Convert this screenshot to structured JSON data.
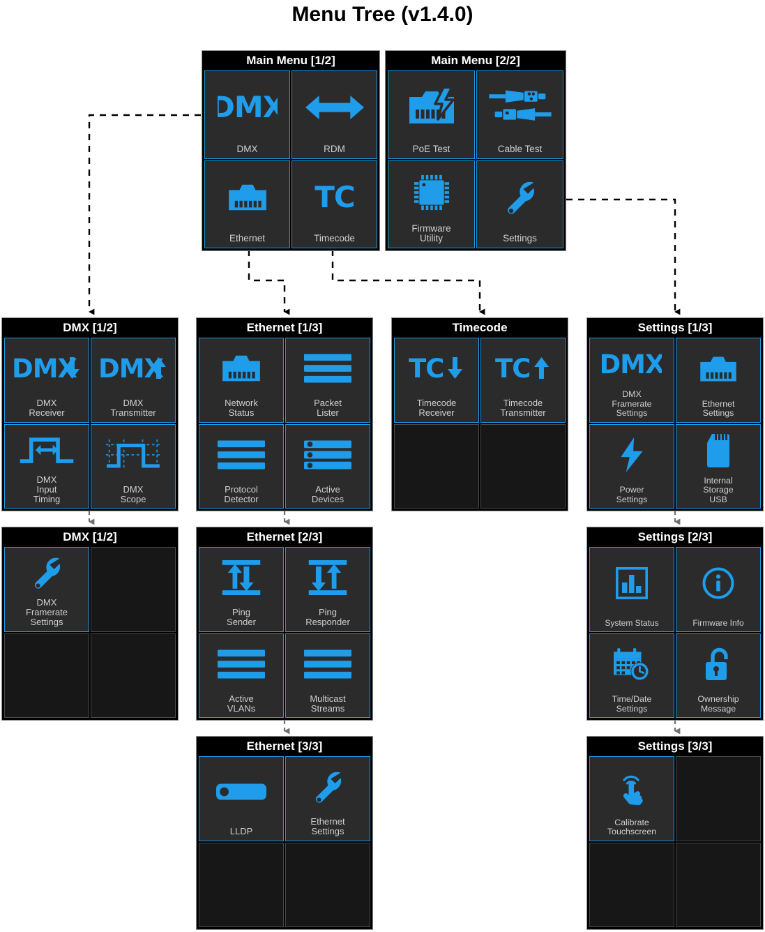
{
  "title": "Menu Tree (v1.4.0)",
  "colors": {
    "accent": "#1f9cea",
    "panel_bg": "#000000",
    "tile_bg": "#2b2b2b",
    "tile_empty_bg": "#171717",
    "label": "#d0d0d0",
    "page_bg": "#ffffff"
  },
  "panels": [
    {
      "id": "main-menu-1",
      "title": "Main Menu [1/2]",
      "tiles": [
        {
          "label": "DMX",
          "icon": "dmx-wordmark-icon"
        },
        {
          "label": "RDM",
          "icon": "double-arrow-icon"
        },
        {
          "label": "Ethernet",
          "icon": "rj45-jack-icon"
        },
        {
          "label": "Timecode",
          "icon": "tc-wordmark-icon"
        }
      ]
    },
    {
      "id": "main-menu-2",
      "title": "Main Menu [2/2]",
      "tiles": [
        {
          "label": "PoE Test",
          "icon": "poe-jack-bolt-icon"
        },
        {
          "label": "Cable Test",
          "icon": "xlr-connectors-icon"
        },
        {
          "label": "Firmware\nUtility",
          "icon": "chip-icon"
        },
        {
          "label": "Settings",
          "icon": "wrench-icon"
        }
      ]
    },
    {
      "id": "dmx-1",
      "title": "DMX [1/2]",
      "tiles": [
        {
          "label": "DMX\nReceiver",
          "icon": "dmx-down-arrow-icon"
        },
        {
          "label": "DMX\nTransmitter",
          "icon": "dmx-up-arrow-icon"
        },
        {
          "label": "DMX\nInput\nTiming",
          "icon": "pulse-width-icon"
        },
        {
          "label": "DMX\nScope",
          "icon": "scope-waveform-icon"
        }
      ]
    },
    {
      "id": "dmx-2",
      "title": "DMX [1/2]",
      "tiles": [
        {
          "label": "DMX\nFramerate\nSettings",
          "icon": "wrench-icon"
        },
        {
          "label": "",
          "icon": "none"
        },
        {
          "label": "",
          "icon": "none"
        },
        {
          "label": "",
          "icon": "none"
        }
      ]
    },
    {
      "id": "ethernet-1",
      "title": "Ethernet [1/3]",
      "tiles": [
        {
          "label": "Network\nStatus",
          "icon": "rj45-jack-icon"
        },
        {
          "label": "Packet\nLister",
          "icon": "list-bars-icon"
        },
        {
          "label": "Protocol\nDetector",
          "icon": "list-bars-icon"
        },
        {
          "label": "Active\nDevices",
          "icon": "device-list-icon"
        }
      ]
    },
    {
      "id": "ethernet-2",
      "title": "Ethernet [2/3]",
      "tiles": [
        {
          "label": "Ping\nSender",
          "icon": "ping-sender-icon"
        },
        {
          "label": "Ping\nResponder",
          "icon": "ping-responder-icon"
        },
        {
          "label": "Active\nVLANs",
          "icon": "list-bars-icon"
        },
        {
          "label": "Multicast\nStreams",
          "icon": "list-bars-icon"
        }
      ]
    },
    {
      "id": "ethernet-3",
      "title": "Ethernet [3/3]",
      "tiles": [
        {
          "label": "LLDP",
          "icon": "pill-tag-icon"
        },
        {
          "label": "Ethernet\nSettings",
          "icon": "wrench-icon"
        },
        {
          "label": "",
          "icon": "none"
        },
        {
          "label": "",
          "icon": "none"
        }
      ]
    },
    {
      "id": "timecode-1",
      "title": "Timecode",
      "tiles": [
        {
          "label": "Timecode\nReceiver",
          "icon": "tc-down-arrow-icon"
        },
        {
          "label": "Timecode\nTransmitter",
          "icon": "tc-up-arrow-icon"
        },
        {
          "label": "",
          "icon": "none"
        },
        {
          "label": "",
          "icon": "none"
        }
      ]
    },
    {
      "id": "settings-1",
      "title": "Settings [1/3]",
      "tiles": [
        {
          "label": "DMX\nFramerate\nSettings",
          "icon": "dmx-wordmark-icon"
        },
        {
          "label": "Ethernet\nSettings",
          "icon": "rj45-jack-icon"
        },
        {
          "label": "Power\nSettings",
          "icon": "bolt-icon"
        },
        {
          "label": "Internal\nStorage\nUSB",
          "icon": "sd-card-icon"
        }
      ]
    },
    {
      "id": "settings-2",
      "title": "Settings [2/3]",
      "tiles": [
        {
          "label": "System Status",
          "icon": "bar-chart-icon"
        },
        {
          "label": "Firmware Info",
          "icon": "info-circle-icon"
        },
        {
          "label": "Time/Date\nSettings",
          "icon": "calendar-clock-icon"
        },
        {
          "label": "Ownership\nMessage",
          "icon": "unlocked-padlock-icon"
        }
      ]
    },
    {
      "id": "settings-3",
      "title": "Settings [3/3]",
      "tiles": [
        {
          "label": "Calibrate\nTouchscreen",
          "icon": "touch-hand-icon"
        },
        {
          "label": "",
          "icon": "none"
        },
        {
          "label": "",
          "icon": "none"
        },
        {
          "label": "",
          "icon": "none"
        }
      ]
    }
  ]
}
